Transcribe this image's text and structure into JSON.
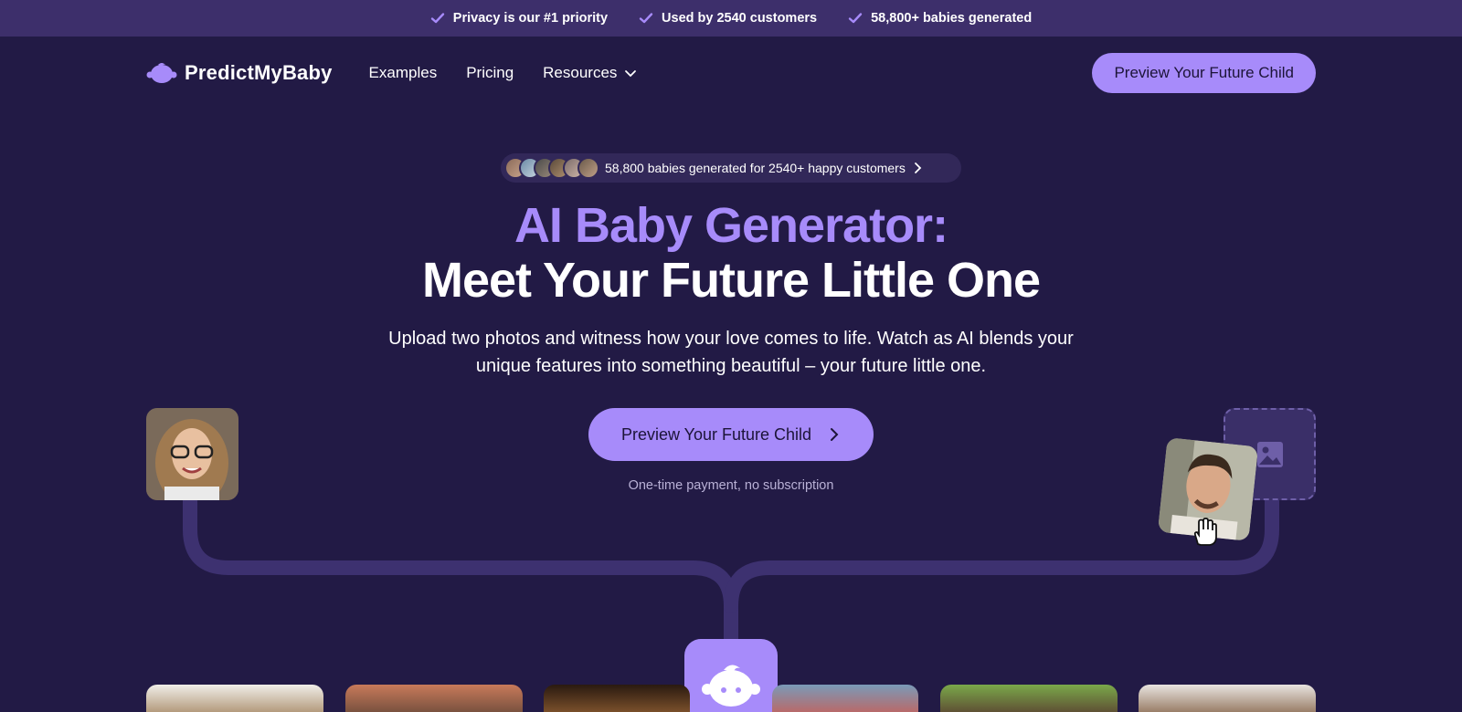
{
  "topbar": {
    "items": [
      "Privacy is our #1 priority",
      "Used by 2540 customers",
      "58,800+ babies generated"
    ]
  },
  "nav": {
    "logo_text": "PredictMyBaby",
    "links": [
      "Examples",
      "Pricing",
      "Resources"
    ],
    "cta_label": "Preview Your Future Child"
  },
  "hero": {
    "social_proof": "58,800 babies generated for 2540+ happy customers",
    "title_line1": "AI Baby Generator:",
    "title_line2": "Meet Your Future Little One",
    "subtitle": "Upload two photos and witness how your love comes to life. Watch as AI blends your unique features into something beautiful – your future little one.",
    "cta_label": "Preview Your Future Child",
    "note": "One-time payment, no subscription"
  },
  "icons": {
    "check": "check-icon",
    "chevron_down": "chevron-down-icon",
    "chevron_right": "chevron-right-icon",
    "image_placeholder": "image-icon",
    "hand_cursor": "hand-cursor-icon",
    "baby": "baby-icon"
  },
  "colors": {
    "background": "#221a45",
    "topbar": "#3d2f6b",
    "accent": "#a78bfa",
    "connector": "#3d3170"
  }
}
